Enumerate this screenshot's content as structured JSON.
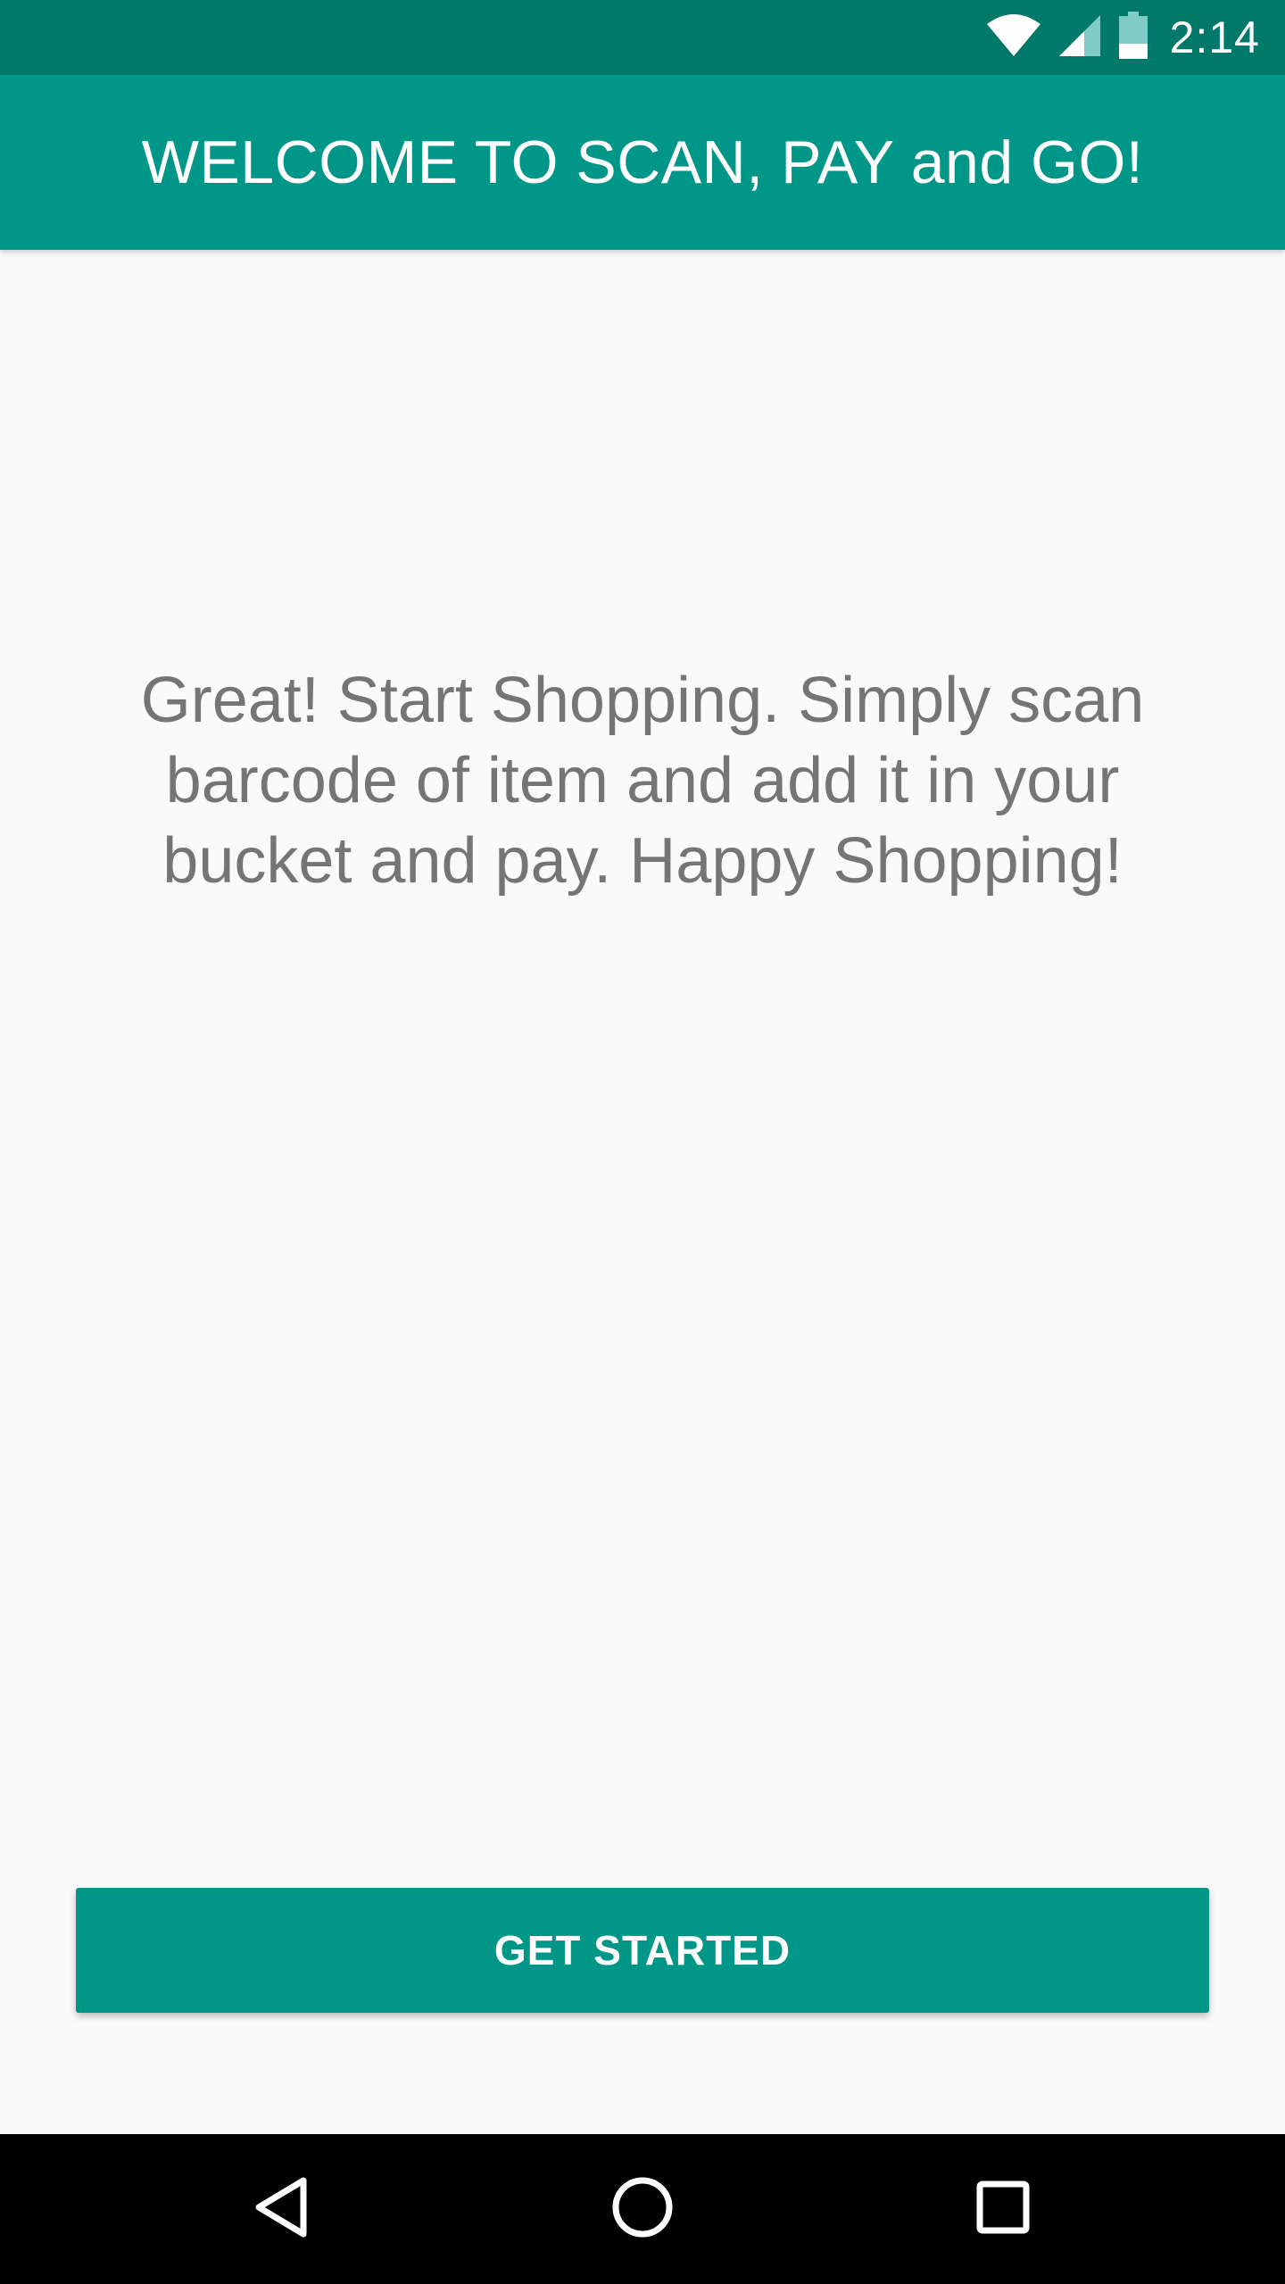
{
  "status_bar": {
    "time": "2:14",
    "background_color": "#00796b",
    "icons": [
      "wifi-icon",
      "cell-signal-icon",
      "battery-icon"
    ]
  },
  "app_bar": {
    "title": "WELCOME TO SCAN, PAY and GO!",
    "background_color": "#009688"
  },
  "main": {
    "message": "Great! Start Shopping. Simply scan barcode of item and add it in your bucket and pay. Happy Shopping!"
  },
  "actions": {
    "get_started_label": "GET STARTED",
    "button_color": "#009688"
  },
  "nav_bar": {
    "icons": [
      "back-icon",
      "home-icon",
      "recents-icon"
    ]
  }
}
